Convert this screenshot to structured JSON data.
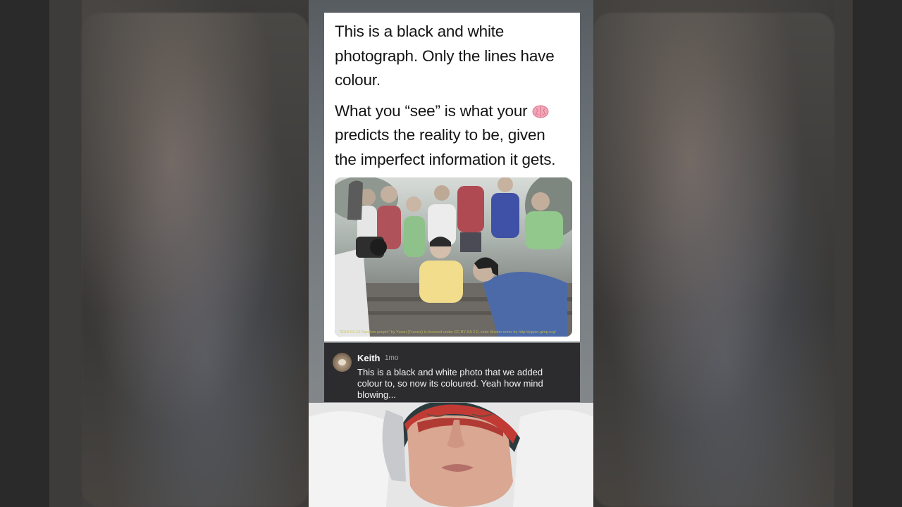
{
  "post": {
    "paragraph1": "This is a black and white photograph. Only the lines have colour.",
    "paragraph2_before": "What you “see” is what your",
    "paragraph2_after": "predicts the reality to be, given the imperfect information it gets.",
    "inline_icon": "brain-icon",
    "photo_credit": "\"2018-02-12 Random people\" by Yuwei (Francis) is licensed under CC BY-SA 2.0, color illusion remix by http://pippin.gimp.org/"
  },
  "comment": {
    "author": "Keith",
    "time": "1mo",
    "text": "This is a black and white photo that we added colour to, so now its coloured. Yeah how mind blowing..."
  },
  "colors": {
    "post_background": "#ffffff",
    "comment_background": "#2c2c2e",
    "page_background": "#1e1e1e"
  }
}
